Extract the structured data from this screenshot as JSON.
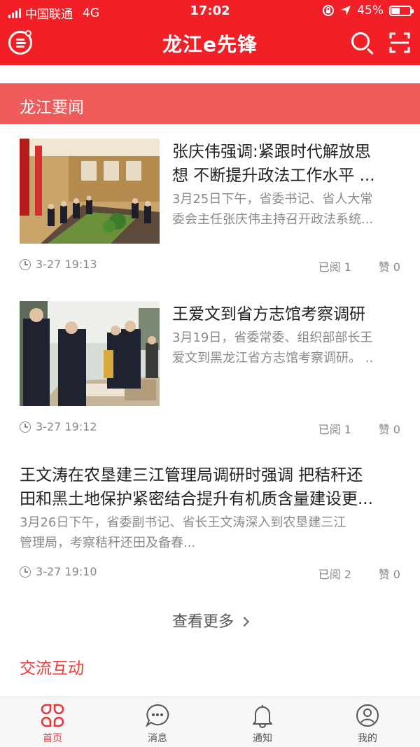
{
  "status_bar": {
    "carrier": "中国联通",
    "network": "4G",
    "time": "17:02",
    "battery_text": "45%",
    "battery_level": 0.45
  },
  "header": {
    "title": "龙江e先锋"
  },
  "section_news": {
    "title": "龙江要闻"
  },
  "news": [
    {
      "title": "张庆伟强调:紧跟时代解放思想 不断提升政法工作水平 ...",
      "title_line1": "张庆伟强调:紧跟时代解放思",
      "title_line2": "想 不断提升政法工作水平 ...",
      "summary_line1": "3月25日下午，省委书记、省人大常",
      "summary_line2": "委会主任张庆伟主持召开政法系统...",
      "time": "3-27 19:13",
      "reads": "已阅 1",
      "likes": "赞  0"
    },
    {
      "title_line1": "王爱文到省方志馆考察调研",
      "summary_line1": "3月19日，省委常委、组织部部长王",
      "summary_line2": "爱文到黑龙江省方志馆考察调研。 ..",
      "time": "3-27 19:12",
      "reads": "已阅 1",
      "likes": "赞  0"
    },
    {
      "title_line1": "王文涛在农垦建三江管理局调研时强调 把秸秆还",
      "title_line2": "田和黑土地保护紧密结合提升有机质含量建设更...",
      "summary_line1": "3月26日下午，省委副书记、省长王文涛深入到农垦建三江",
      "summary_line2": "管理局，考察秸秆还田及备春...",
      "time": "3-27 19:10",
      "reads": "已阅 2",
      "likes": "赞  0"
    }
  ],
  "more_label": "查看更多",
  "section_interact": {
    "title": "交流互动"
  },
  "tabs": [
    {
      "label": "首页",
      "icon": "home-grid-icon",
      "active": true
    },
    {
      "label": "消息",
      "icon": "chat-bubble-icon",
      "active": false
    },
    {
      "label": "通知",
      "icon": "bell-icon",
      "active": false
    },
    {
      "label": "我的",
      "icon": "user-icon",
      "active": false
    }
  ],
  "colors": {
    "brand_red": "#f21f27",
    "section_red": "#ef5b5b",
    "active_tab": "#e8363a"
  }
}
